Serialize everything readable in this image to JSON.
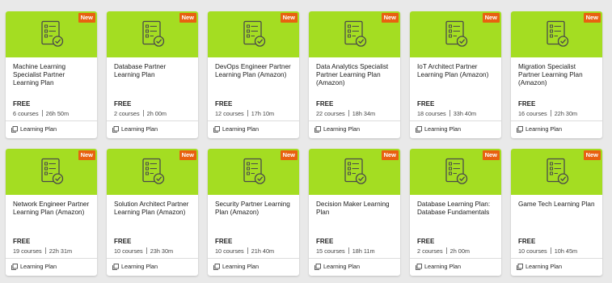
{
  "badge_label": "New",
  "price_label": "FREE",
  "type_label": "Learning Plan",
  "colors": {
    "banner": "#a4dd22",
    "badge": "#e86110",
    "background": "#e9e9e9"
  },
  "icons": {
    "banner": "checklist-document-icon",
    "footer": "learning-plan-icon"
  },
  "cards": [
    {
      "title": "Machine Learning Specialist Partner Learning Plan",
      "courses": "6 courses",
      "duration": "26h 50m"
    },
    {
      "title": "Database Partner Learning Plan",
      "courses": "2 courses",
      "duration": "2h 00m"
    },
    {
      "title": "DevOps Engineer Partner Learning Plan (Amazon)",
      "courses": "12 courses",
      "duration": "17h 10m"
    },
    {
      "title": "Data Analytics Specialist Partner Learning Plan (Amazon)",
      "courses": "22 courses",
      "duration": "18h 34m"
    },
    {
      "title": "IoT Architect Partner Learning Plan (Amazon)",
      "courses": "18 courses",
      "duration": "33h 40m"
    },
    {
      "title": "Migration Specialist Partner Learning Plan (Amazon)",
      "courses": "16 courses",
      "duration": "22h 30m"
    },
    {
      "title": "Network Engineer Partner Learning Plan (Amazon)",
      "courses": "19 courses",
      "duration": "22h 31m"
    },
    {
      "title": "Solution Architect Partner Learning Plan (Amazon)",
      "courses": "10 courses",
      "duration": "23h 30m"
    },
    {
      "title": "Security Partner Learning Plan (Amazon)",
      "courses": "10 courses",
      "duration": "21h 40m"
    },
    {
      "title": "Decision Maker Learning Plan",
      "courses": "15 courses",
      "duration": "18h 11m"
    },
    {
      "title": "Database Learning Plan: Database Fundamentals",
      "courses": "2 courses",
      "duration": "2h 00m"
    },
    {
      "title": "Game Tech Learning Plan",
      "courses": "10 courses",
      "duration": "10h 45m"
    }
  ]
}
